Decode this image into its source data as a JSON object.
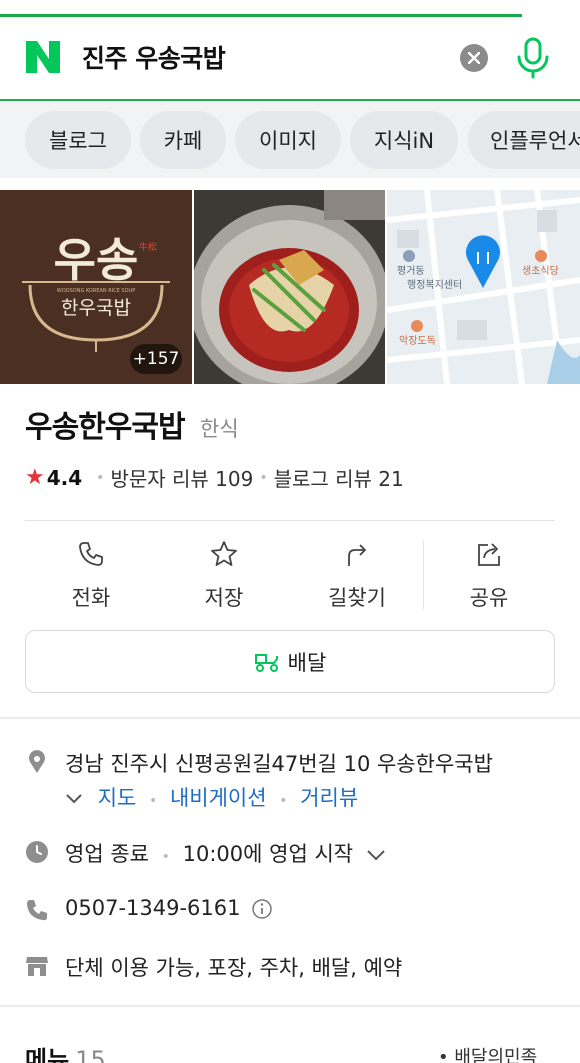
{
  "search": {
    "query": "진주 우송국밥"
  },
  "chips": [
    {
      "label": "블로그"
    },
    {
      "label": "카페"
    },
    {
      "label": "이미지"
    },
    {
      "label": "지식iN"
    },
    {
      "label": "인플루언서"
    }
  ],
  "photos": {
    "logo_text_main": "우송",
    "logo_text_sub": "한우국밥",
    "logo_text_seal": "牛松",
    "logo_text_en": "WOOSONG KOREAN RICE SOUP",
    "more_count": "+157",
    "map_labels": [
      "평거동",
      "행정복지센터",
      "생초식당",
      "악장도독"
    ]
  },
  "place": {
    "name": "우송한우국밥",
    "category": "한식",
    "rating": "4.4",
    "visitor_reviews": "방문자 리뷰 109",
    "blog_reviews": "블로그 리뷰 21"
  },
  "actions": [
    {
      "label": "전화",
      "icon": "phone-icon"
    },
    {
      "label": "저장",
      "icon": "star-icon"
    },
    {
      "label": "길찾기",
      "icon": "directions-icon"
    },
    {
      "label": "공유",
      "icon": "share-icon"
    }
  ],
  "delivery": {
    "label": "배달"
  },
  "info": {
    "address": "경남 진주시 신평공원길47번길 10 우송한우국밥",
    "links": [
      "지도",
      "내비게이션",
      "거리뷰"
    ],
    "hours_status": "영업 종료",
    "hours_next": "10:00에 영업 시작",
    "phone": "0507-1349-6161",
    "amenities": "단체 이용 가능, 포장, 주차, 배달, 예약"
  },
  "menu": {
    "title": "메뉴",
    "count": "15",
    "source": "배달의민족"
  },
  "colors": {
    "brand_green": "#03c75a",
    "link_blue": "#1f6dc4",
    "star_red": "#e5343a"
  }
}
